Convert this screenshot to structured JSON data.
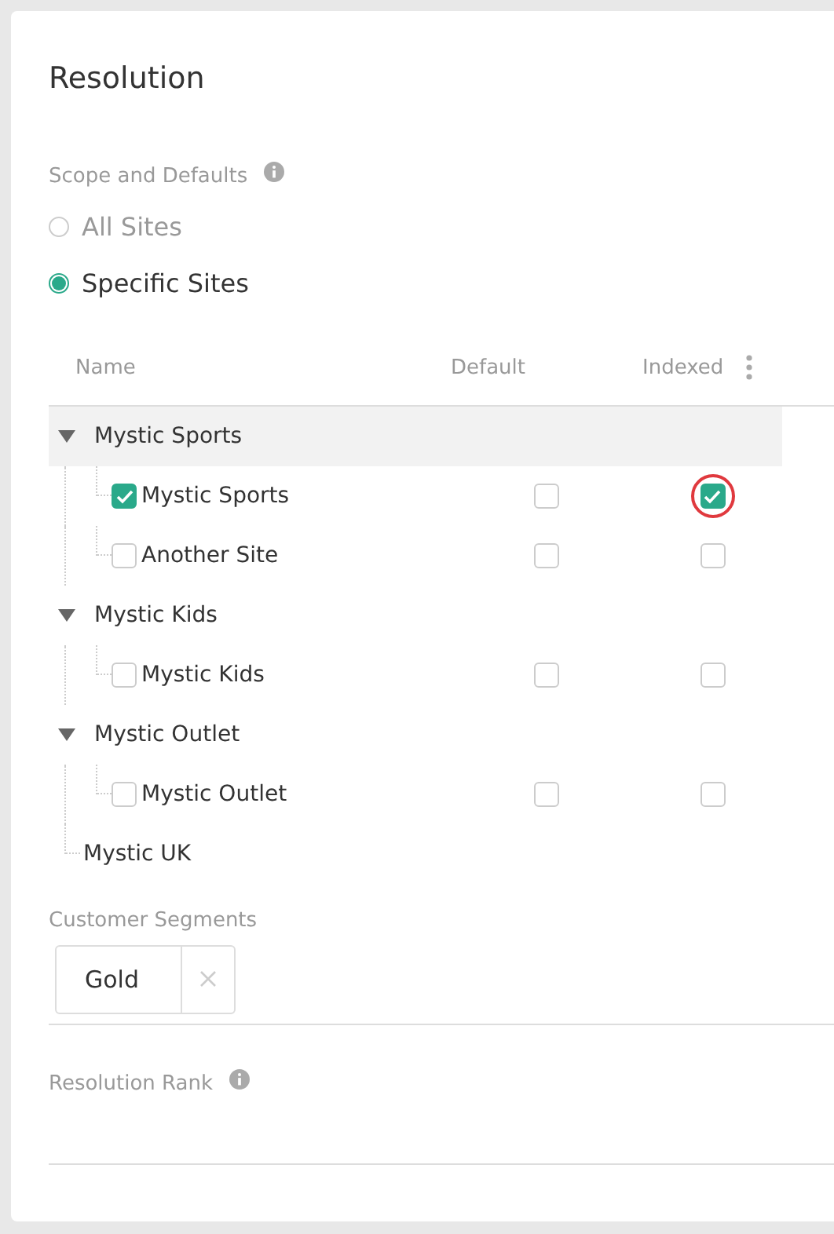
{
  "title": "Resolution",
  "scope": {
    "label": "Scope and Defaults",
    "options": [
      {
        "label": "All Sites",
        "selected": false
      },
      {
        "label": "Specific Sites",
        "selected": true
      }
    ]
  },
  "table": {
    "columns": [
      "Name",
      "Default",
      "Indexed"
    ],
    "tree": [
      {
        "kind": "group",
        "label": "Mystic Sports",
        "expanded": true,
        "selected": true,
        "children": [
          {
            "label": "Mystic Sports",
            "checked": true,
            "default": false,
            "indexed": true,
            "indexed_highlighted": true
          },
          {
            "label": "Another Site",
            "checked": false,
            "default": false,
            "indexed": false,
            "indexed_highlighted": false
          }
        ]
      },
      {
        "kind": "group",
        "label": "Mystic Kids",
        "expanded": true,
        "selected": false,
        "children": [
          {
            "label": "Mystic Kids",
            "checked": false,
            "default": false,
            "indexed": false,
            "indexed_highlighted": false
          }
        ]
      },
      {
        "kind": "group",
        "label": "Mystic Outlet",
        "expanded": true,
        "selected": false,
        "children": [
          {
            "label": "Mystic Outlet",
            "checked": false,
            "default": false,
            "indexed": false,
            "indexed_highlighted": false
          }
        ]
      },
      {
        "kind": "leaf",
        "label": "Mystic UK"
      }
    ]
  },
  "segments": {
    "label": "Customer Segments",
    "tags": [
      "Gold"
    ]
  },
  "rank": {
    "label": "Resolution Rank"
  }
}
